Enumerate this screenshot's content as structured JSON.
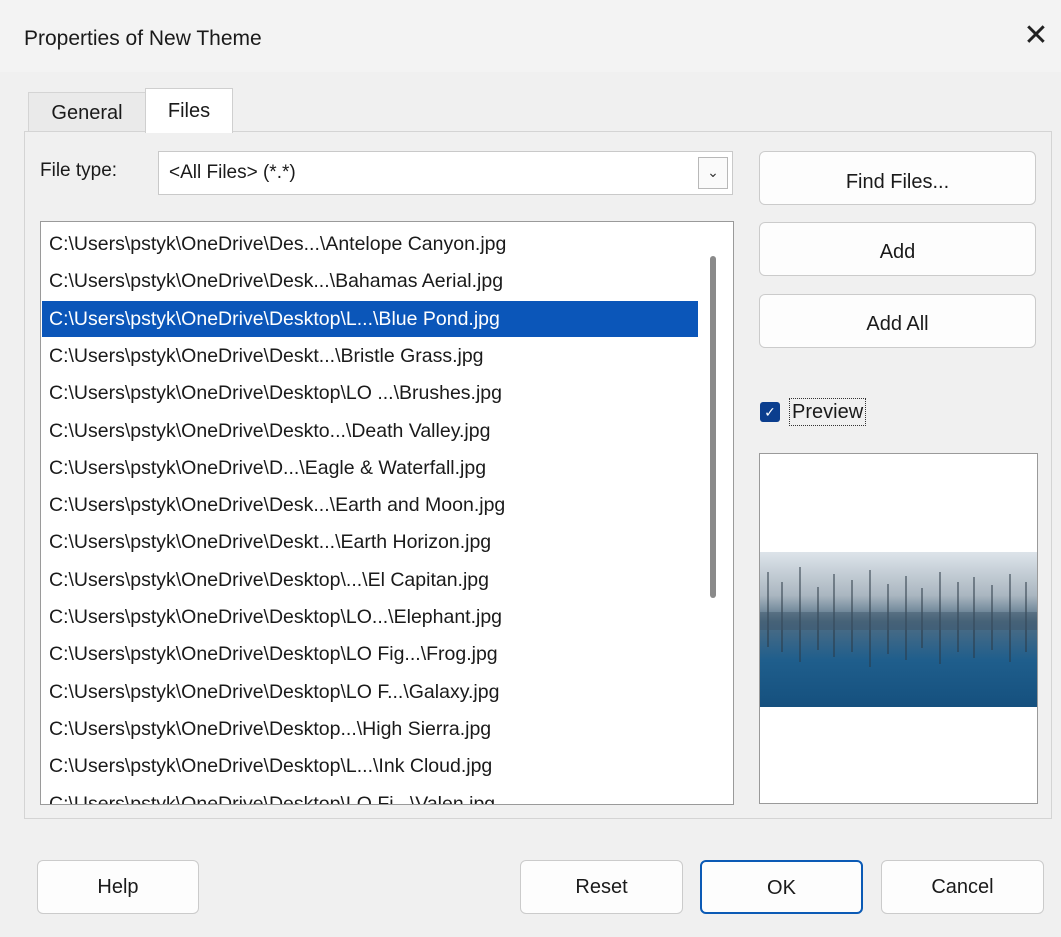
{
  "window": {
    "title": "Properties of New Theme",
    "close_glyph": "✕"
  },
  "tabs": [
    {
      "label": "General"
    },
    {
      "label": "Files"
    }
  ],
  "file_type": {
    "label": "File type:",
    "value": "<All Files> (*.*)"
  },
  "files": [
    "C:\\Users\\pstyk\\OneDrive\\Des...\\Antelope Canyon.jpg",
    "C:\\Users\\pstyk\\OneDrive\\Desk...\\Bahamas Aerial.jpg",
    "C:\\Users\\pstyk\\OneDrive\\Desktop\\L...\\Blue Pond.jpg",
    "C:\\Users\\pstyk\\OneDrive\\Deskt...\\Bristle Grass.jpg",
    "C:\\Users\\pstyk\\OneDrive\\Desktop\\LO ...\\Brushes.jpg",
    "C:\\Users\\pstyk\\OneDrive\\Deskto...\\Death Valley.jpg",
    "C:\\Users\\pstyk\\OneDrive\\D...\\Eagle & Waterfall.jpg",
    "C:\\Users\\pstyk\\OneDrive\\Desk...\\Earth and Moon.jpg",
    "C:\\Users\\pstyk\\OneDrive\\Deskt...\\Earth Horizon.jpg",
    "C:\\Users\\pstyk\\OneDrive\\Desktop\\...\\El Capitan.jpg",
    "C:\\Users\\pstyk\\OneDrive\\Desktop\\LO...\\Elephant.jpg",
    "C:\\Users\\pstyk\\OneDrive\\Desktop\\LO Fig...\\Frog.jpg",
    "C:\\Users\\pstyk\\OneDrive\\Desktop\\LO F...\\Galaxy.jpg",
    "C:\\Users\\pstyk\\OneDrive\\Desktop...\\High Sierra.jpg",
    "C:\\Users\\pstyk\\OneDrive\\Desktop\\L...\\Ink Cloud.jpg",
    "C:\\Users\\pstyk\\OneDrive\\Desktop\\LO Fi...\\Valen.jpg"
  ],
  "selected_file_index": 2,
  "buttons": {
    "find_files": "Find Files...",
    "add": "Add",
    "add_all": "Add All"
  },
  "preview": {
    "label": "Preview",
    "checked": true
  },
  "footer": {
    "help": "Help",
    "reset": "Reset",
    "ok": "OK",
    "cancel": "Cancel"
  },
  "colors": {
    "selection": "#0b56b9",
    "checkbox": "#0b3e8e",
    "ok_border": "#0b5ab5"
  }
}
